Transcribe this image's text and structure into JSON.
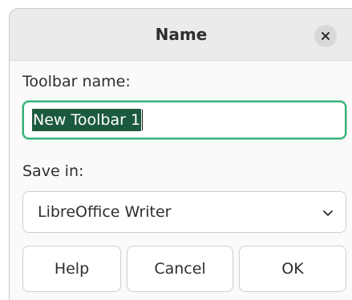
{
  "dialog": {
    "title": "Name",
    "close_icon": "close-icon"
  },
  "toolbar_name": {
    "label": "Toolbar name:",
    "value": "New Toolbar 1",
    "selected": true
  },
  "save_in": {
    "label": "Save in:",
    "selected_value": "LibreOffice Writer",
    "icon": "chevron-down-icon"
  },
  "buttons": {
    "help": "Help",
    "cancel": "Cancel",
    "ok": "OK"
  },
  "colors": {
    "focus_border": "#33b07a",
    "selection_bg": "#1c5a3f"
  }
}
